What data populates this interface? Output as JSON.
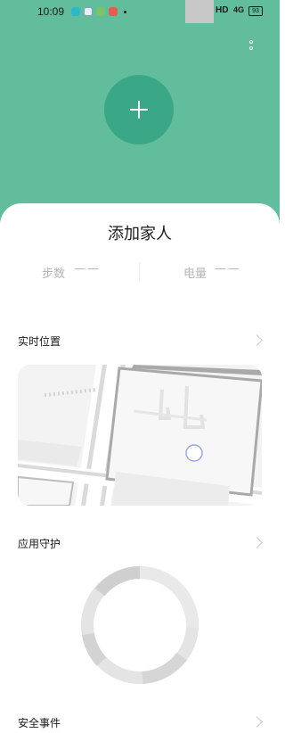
{
  "status_bar": {
    "time": "10:09",
    "network": "HD",
    "signal": "4G",
    "battery": "93"
  },
  "header": {
    "background_color": "#62bd9c",
    "more_icon": "more-vertical-icon",
    "add_icon": "plus-icon"
  },
  "card": {
    "title": "添加家人",
    "steps_label": "步数",
    "steps_value": "——",
    "battery_label": "电量",
    "battery_value": "——"
  },
  "sections": {
    "location": "实时位置",
    "app_guard": "应用守护",
    "safety_events": "安全事件"
  },
  "icons": {
    "chevron": "chevron-right-icon",
    "location_marker": "location-circle-icon"
  }
}
